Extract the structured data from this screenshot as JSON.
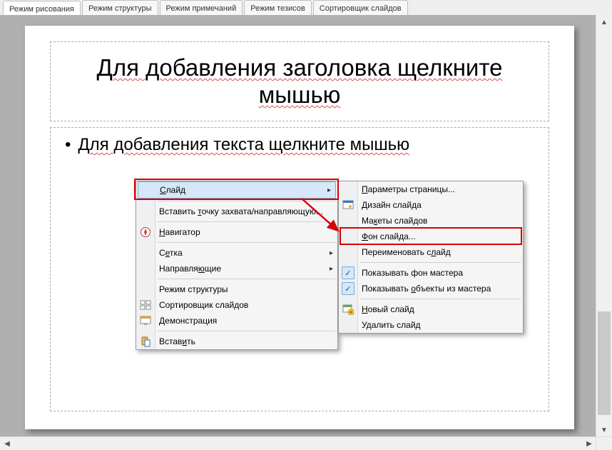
{
  "tabs": [
    {
      "label": "Режим рисования",
      "active": true
    },
    {
      "label": "Режим структуры",
      "active": false
    },
    {
      "label": "Режим примечаний",
      "active": false
    },
    {
      "label": "Режим тезисов",
      "active": false
    },
    {
      "label": "Сортировщик слайдов",
      "active": false
    }
  ],
  "slide": {
    "title_placeholder": "Для добавления заголовка щелкните мышью",
    "content_placeholder": "Для добавления текста щелкните мышью"
  },
  "ctx1": {
    "slide": "Слайд",
    "insert_point": "Вставить точку захвата/направляющую...",
    "navigator": "Навигатор",
    "grid": "Сетка",
    "guides": "Направляющие",
    "outline_mode": "Режим структуры",
    "sorter": "Сортировщик слайдов",
    "demo": "Демонстрация",
    "paste": "Вставить"
  },
  "ctx2": {
    "page_params": "Параметры страницы...",
    "design": "Дизайн слайда",
    "layouts": "Макеты слайдов",
    "bg": "Фон слайда...",
    "rename": "Переименовать слайд",
    "show_master_bg": "Показывать фон мастера",
    "show_master_obj": "Показывать объекты из мастера",
    "new_slide": "Новый слайд",
    "delete_slide": "Удалить слайд"
  }
}
